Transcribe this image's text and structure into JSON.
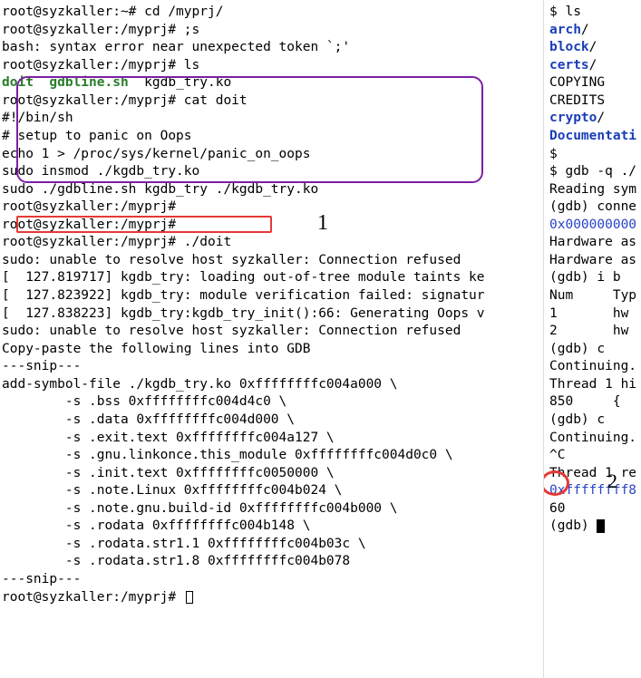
{
  "left": {
    "l1_prompt": "root@syzkaller:~# ",
    "l1_cmd": "cd /myprj/",
    "l2_prompt": "root@syzkaller:/myprj# ",
    "l2_cmd": ";s",
    "l3": "bash: syntax error near unexpected token `;'",
    "l4_prompt": "root@syzkaller:/myprj# ",
    "l4_cmd": "ls",
    "l5_doit": "doit",
    "l5_gdbline": "  gdbline.sh",
    "l5_kgdb": "  kgdb_try.ko",
    "l6_prompt": "root@syzkaller:/myprj# ",
    "l6_cmd": "cat doit",
    "l7": "#!/bin/sh",
    "l8": "# setup to panic on Oops",
    "l9": "echo 1 > /proc/sys/kernel/panic_on_oops",
    "l10": "sudo insmod ./kgdb_try.ko",
    "l11": "sudo ./gdbline.sh kgdb_try ./kgdb_try.ko",
    "l12": "root@syzkaller:/myprj#",
    "l13": "root@syzkaller:/myprj#",
    "l14_prompt": "root@syzkaller:/myprj# ",
    "l14_cmd": "./doit",
    "l15": "sudo: unable to resolve host syzkaller: Connection refused",
    "l16": "[  127.819717] kgdb_try: loading out-of-tree module taints ke",
    "l17": "[  127.823922] kgdb_try: module verification failed: signatur",
    "l18": "[  127.838223] kgdb_try:kgdb_try_init():66: Generating Oops v",
    "l19": "sudo: unable to resolve host syzkaller: Connection refused",
    "l20": "Copy-paste the following lines into GDB",
    "l21": "---snip---",
    "l22": "add-symbol-file ./kgdb_try.ko 0xffffffffc004a000 \\",
    "l23": "        -s .bss 0xffffffffc004d4c0 \\",
    "l24": "        -s .data 0xffffffffc004d000 \\",
    "l25": "        -s .exit.text 0xffffffffc004a127 \\",
    "l26": "        -s .gnu.linkonce.this_module 0xffffffffc004d0c0 \\",
    "l27": "        -s .init.text 0xffffffffc0050000 \\",
    "l28": "        -s .note.Linux 0xffffffffc004b024 \\",
    "l29": "        -s .note.gnu.build-id 0xffffffffc004b000 \\",
    "l30": "        -s .rodata 0xffffffffc004b148 \\",
    "l31": "        -s .rodata.str1.1 0xffffffffc004b03c \\",
    "l32": "        -s .rodata.str1.8 0xffffffffc004b078",
    "l33": "---snip---",
    "l34": "",
    "l35": "root@syzkaller:/myprj# ",
    "label1": "1"
  },
  "right": {
    "r1": "$ ls",
    "r2_dir": "arch",
    "r3_dir": "block",
    "r4_dir": "certs",
    "r5": "COPYING",
    "r6": "CREDITS",
    "r7_dir": "crypto",
    "r8_dir": "Documentati",
    "r9": "$",
    "r10": "$ gdb -q ./",
    "r11": "Reading sym",
    "r12a": "(gdb) ",
    "r12b": "conne",
    "r13": "0x000000000",
    "r14": "Hardware as",
    "r15": "Hardware as",
    "r16a": "(gdb) ",
    "r16b": "i b",
    "r17": "Num     Typ",
    "r18": "1       hw ",
    "r19": "2       hw ",
    "r20a": "(gdb) ",
    "r20b": "c",
    "r21": "Continuing.",
    "r22": "",
    "r23": "Thread 1 hi",
    "r24": "850     {",
    "r25a": "(gdb) ",
    "r25b": "c",
    "r26": "Continuing.",
    "r27": "^C",
    "r28": "Thread 1 re",
    "r29": "0xffffffff8",
    "r30": "60",
    "r31": "(gdb) ",
    "label2": "2"
  },
  "slash": "/"
}
